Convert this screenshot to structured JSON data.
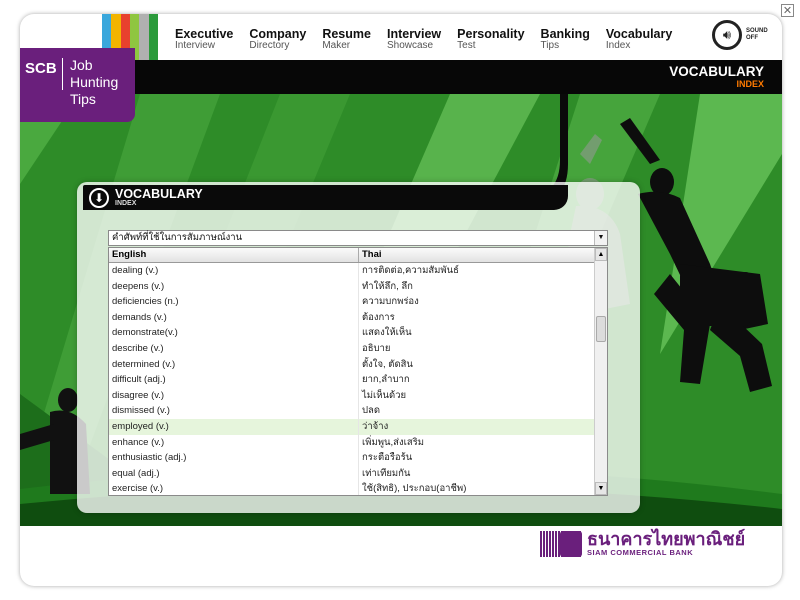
{
  "window": {
    "close_glyph": "✕"
  },
  "stripes": [
    "#3aa7dc",
    "#f2b400",
    "#e8412e",
    "#8fc640",
    "#b0b0b0",
    "#2b9a3b"
  ],
  "nav": [
    {
      "title": "Executive",
      "subtitle": "Interview"
    },
    {
      "title": "Company",
      "subtitle": "Directory"
    },
    {
      "title": "Resume",
      "subtitle": "Maker"
    },
    {
      "title": "Interview",
      "subtitle": "Showcase"
    },
    {
      "title": "Personality",
      "subtitle": "Test"
    },
    {
      "title": "Banking",
      "subtitle": "Tips"
    },
    {
      "title": "Vocabulary",
      "subtitle": "Index"
    }
  ],
  "sound": {
    "line1": "SOUND",
    "line2": "OFF",
    "icon": "speaker-icon"
  },
  "logo": {
    "brand": "SCB",
    "line1": "Job",
    "line2": "Hunting",
    "line3": "Tips"
  },
  "header": {
    "title": "VOCABULARY",
    "subtitle": "INDEX",
    "subtitle_color": "#ff7a00"
  },
  "panel": {
    "title": "VOCABULARY",
    "subtitle": "INDEX",
    "dropdown_value": "คำศัพท์ที่ใช้ในการสัมภาษณ์งาน",
    "columns": [
      "English",
      "Thai"
    ],
    "rows": [
      {
        "en": "dealing (v.)",
        "th": "การติดต่อ,ความสัมพันธ์"
      },
      {
        "en": "deepens (v.)",
        "th": "ทำให้ลึก, ลึก"
      },
      {
        "en": "deficiencies (n.)",
        "th": "ความบกพร่อง"
      },
      {
        "en": "demands (v.)",
        "th": "ต้องการ"
      },
      {
        "en": "demonstrate(v.)",
        "th": "แสดงให้เห็น"
      },
      {
        "en": "describe (v.)",
        "th": "อธิบาย"
      },
      {
        "en": "determined (v.)",
        "th": "ตั้งใจ, ตัดสิน"
      },
      {
        "en": "difficult (adj.)",
        "th": "ยาก,ลำบาก"
      },
      {
        "en": "disagree (v.)",
        "th": "ไม่เห็นด้วย"
      },
      {
        "en": "dismissed (v.)",
        "th": "ปลด"
      },
      {
        "en": "employed (v.)",
        "th": "ว่าจ้าง",
        "selected": true
      },
      {
        "en": "enhance (v.)",
        "th": "เพิ่มพูน,ส่งเสริม"
      },
      {
        "en": "enthusiastic (adj.)",
        "th": "กระตือรือร้น"
      },
      {
        "en": "equal (adj.)",
        "th": "เท่าเทียมกัน"
      },
      {
        "en": "exercise (v.)",
        "th": "ใช้(สิทธิ), ประกอบ(อาชีพ)"
      }
    ]
  },
  "footer": {
    "thai": "ธนาคารไทยพาณิชย์",
    "english": "SIAM COMMERCIAL BANK"
  }
}
